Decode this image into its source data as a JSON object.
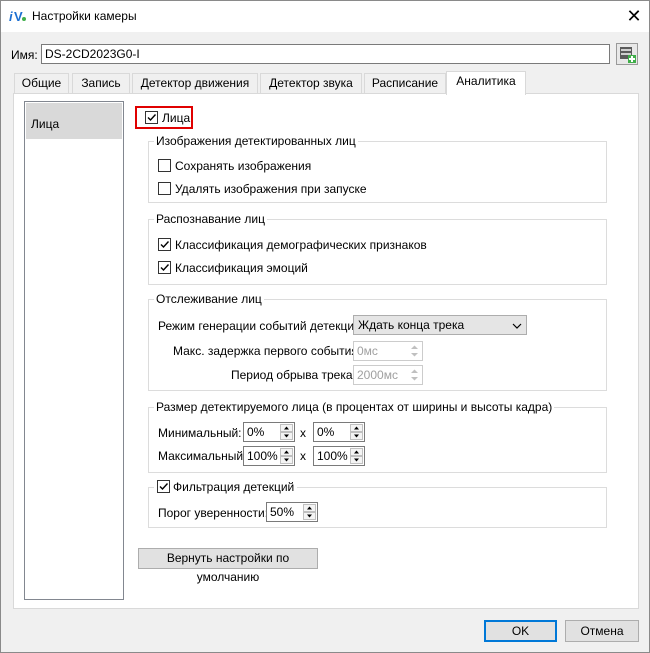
{
  "window": {
    "title": "Настройки камеры"
  },
  "name_row": {
    "label": "Имя:",
    "value": "DS-2CD2023G0-I"
  },
  "tabs": [
    {
      "label": "Общие"
    },
    {
      "label": "Запись"
    },
    {
      "label": "Детектор движения"
    },
    {
      "label": "Детектор звука"
    },
    {
      "label": "Расписание"
    },
    {
      "label": "Аналитика"
    }
  ],
  "sidebar": {
    "items": [
      {
        "label": "Лица"
      }
    ]
  },
  "faces": {
    "label": "Лица",
    "checked": true,
    "images_group": {
      "title": "Изображения детектированных лиц",
      "save_images": {
        "label": "Сохранять изображения",
        "checked": false
      },
      "delete_images": {
        "label": "Удалять изображения при запуске",
        "checked": false
      }
    },
    "recognition_group": {
      "title": "Распознавание лиц",
      "demographics": {
        "label": "Классификация демографических признаков",
        "checked": true
      },
      "emotions": {
        "label": "Классификация эмоций",
        "checked": true
      }
    },
    "tracking_group": {
      "title": "Отслеживание лиц",
      "mode_label": "Режим генерации событий детекции:",
      "mode_value": "Ждать конца трека",
      "max_delay_label": "Макс. задержка первого события:",
      "max_delay_value": "0мс",
      "break_period_label": "Период обрыва трека:",
      "break_period_value": "2000мс"
    },
    "size_group": {
      "title": "Размер детектируемого лица (в процентах от ширины и высоты кадра)",
      "min_label": "Минимальный:",
      "min_w": "0%",
      "min_h": "0%",
      "max_label": "Максимальный:",
      "max_w": "100%",
      "max_h": "100%",
      "x_sep": "x"
    },
    "filter_group": {
      "title": "Фильтрация детекций",
      "checked": true,
      "threshold_label": "Порог уверенности:",
      "threshold_value": "50%"
    }
  },
  "buttons": {
    "reset": "Вернуть настройки по умолчанию",
    "ok": "OK",
    "cancel": "Отмена"
  },
  "colors": {
    "highlight": "#e00000",
    "accent": "#0078d7"
  },
  "icons": {
    "app": "iv-logo-icon",
    "db": "database-add-icon",
    "close": "close-icon"
  }
}
